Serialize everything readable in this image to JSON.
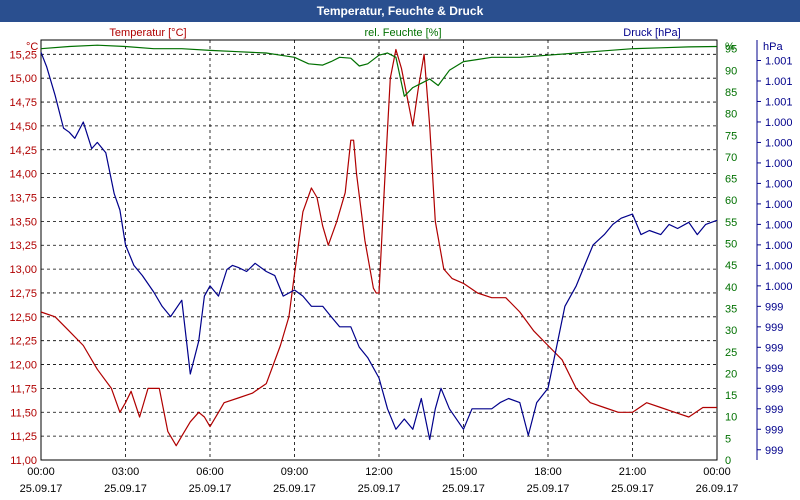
{
  "window": {
    "title": "Temperatur, Feuchte & Druck"
  },
  "chart_data": {
    "type": "line",
    "title": "Temperatur, Feuchte & Druck",
    "grid": true,
    "x": {
      "min_hour": 0,
      "max_hour": 24,
      "ticks": [
        {
          "hour": 0,
          "time": "00:00",
          "date": "25.09.17"
        },
        {
          "hour": 3,
          "time": "03:00",
          "date": "25.09.17"
        },
        {
          "hour": 6,
          "time": "06:00",
          "date": "25.09.17"
        },
        {
          "hour": 9,
          "time": "09:00",
          "date": "25.09.17"
        },
        {
          "hour": 12,
          "time": "12:00",
          "date": "25.09.17"
        },
        {
          "hour": 15,
          "time": "15:00",
          "date": "25.09.17"
        },
        {
          "hour": 18,
          "time": "18:00",
          "date": "25.09.17"
        },
        {
          "hour": 21,
          "time": "21:00",
          "date": "25.09.17"
        },
        {
          "hour": 24,
          "time": "00:00",
          "date": "26.09.17"
        }
      ]
    },
    "axes": {
      "temperature": {
        "label": "Temperatur [°C]",
        "unit": "°C",
        "color": "#b00000",
        "position": "left",
        "min": 11.0,
        "max": 15.4,
        "tick_values": [
          11.0,
          11.25,
          11.5,
          11.75,
          12.0,
          12.25,
          12.5,
          12.75,
          13.0,
          13.25,
          13.5,
          13.75,
          14.0,
          14.25,
          14.5,
          14.75,
          15.0,
          15.25
        ],
        "tick_labels": [
          "11,00",
          "11,25",
          "11,50",
          "11,75",
          "12,00",
          "12,25",
          "12,50",
          "12,75",
          "13,00",
          "13,25",
          "13,50",
          "13,75",
          "14,00",
          "14,25",
          "14,50",
          "14,75",
          "15,00",
          "15,25"
        ]
      },
      "humidity": {
        "label": "rel. Feuchte [%]",
        "unit": "%",
        "color": "#007000",
        "position": "right",
        "min": 0,
        "max": 97,
        "tick_values": [
          0,
          5,
          10,
          15,
          20,
          25,
          30,
          35,
          40,
          45,
          50,
          55,
          60,
          65,
          70,
          75,
          80,
          85,
          90,
          95
        ],
        "tick_labels": [
          "0",
          "5",
          "10",
          "15",
          "20",
          "25",
          "30",
          "35",
          "40",
          "45",
          "50",
          "55",
          "60",
          "65",
          "70",
          "75",
          "80",
          "85",
          "90",
          "95"
        ]
      },
      "pressure": {
        "label": "Druck [hPa]",
        "unit": "hPa",
        "color": "#00008b",
        "position": "right",
        "min": 0,
        "max": 20.5,
        "tick_values": [
          0.5,
          1.5,
          2.5,
          3.5,
          4.5,
          5.5,
          6.5,
          7.5,
          8.5,
          9.5,
          10.5,
          11.5,
          12.5,
          13.5,
          14.5,
          15.5,
          16.5,
          17.5,
          18.5,
          19.5
        ],
        "tick_labels": [
          "999",
          "999",
          "999",
          "999",
          "999",
          "999",
          "999",
          "999",
          "1.000",
          "1.000",
          "1.000",
          "1.000",
          "1.000",
          "1.000",
          "1.000",
          "1.000",
          "1.000",
          "1.001",
          "1.001",
          "1.001"
        ]
      }
    },
    "series": [
      {
        "name": "Temperatur [°C]",
        "axis": "temperature",
        "color": "#b00000",
        "x": [
          0,
          0.5,
          1,
          1.5,
          2,
          2.5,
          2.8,
          3,
          3.2,
          3.5,
          3.8,
          4,
          4.2,
          4.5,
          4.8,
          5,
          5.3,
          5.6,
          5.8,
          6,
          6.3,
          6.5,
          7,
          7.5,
          8,
          8.5,
          8.8,
          9,
          9.3,
          9.6,
          9.8,
          10,
          10.2,
          10.5,
          10.8,
          11,
          11.1,
          11.2,
          11.5,
          11.8,
          11.9,
          12,
          12.2,
          12.4,
          12.6,
          12.8,
          13,
          13.2,
          13.4,
          13.6,
          13.8,
          14,
          14.3,
          14.6,
          15,
          15.5,
          16,
          16.5,
          17,
          17.5,
          18,
          18.5,
          19,
          19.5,
          20,
          20.5,
          21,
          21.5,
          22,
          22.5,
          23,
          23.5,
          24
        ],
        "values": [
          12.55,
          12.5,
          12.35,
          12.2,
          11.95,
          11.75,
          11.5,
          11.6,
          11.72,
          11.45,
          11.75,
          11.75,
          11.75,
          11.3,
          11.15,
          11.25,
          11.4,
          11.5,
          11.45,
          11.35,
          11.5,
          11.6,
          11.65,
          11.7,
          11.8,
          12.2,
          12.5,
          12.95,
          13.6,
          13.85,
          13.75,
          13.45,
          13.25,
          13.5,
          13.8,
          14.35,
          14.35,
          14.0,
          13.3,
          12.8,
          12.75,
          12.75,
          13.9,
          15.0,
          15.3,
          15.1,
          14.8,
          14.5,
          14.9,
          15.25,
          14.5,
          13.5,
          13.0,
          12.9,
          12.85,
          12.75,
          12.7,
          12.7,
          12.55,
          12.35,
          12.2,
          12.05,
          11.75,
          11.6,
          11.55,
          11.5,
          11.5,
          11.6,
          11.55,
          11.5,
          11.45,
          11.55,
          11.55
        ]
      },
      {
        "name": "rel. Feuchte [%]",
        "axis": "humidity",
        "color": "#007000",
        "x": [
          0,
          1,
          2,
          3,
          4,
          5,
          6,
          7,
          8,
          8.5,
          9,
          9.5,
          10,
          10.3,
          10.6,
          11,
          11.3,
          11.6,
          12,
          12.3,
          12.6,
          12.9,
          13.2,
          13.5,
          13.8,
          14.1,
          14.5,
          15,
          15.5,
          16,
          17,
          18,
          19,
          20,
          21,
          22,
          23,
          24
        ],
        "values": [
          95,
          95.5,
          95.8,
          95.5,
          95,
          95,
          94.6,
          94.3,
          94,
          93.5,
          93,
          91.5,
          91.2,
          92,
          93,
          92.8,
          91,
          91.5,
          93.5,
          94,
          93,
          84,
          86,
          87,
          88,
          86.5,
          90,
          92,
          92.5,
          93,
          93,
          93.5,
          94,
          94.5,
          95,
          95.2,
          95.4,
          95.5
        ]
      },
      {
        "name": "Druck [hPa]",
        "axis": "pressure",
        "color": "#00008b",
        "x": [
          0,
          0.2,
          0.5,
          0.8,
          1,
          1.2,
          1.5,
          1.8,
          2,
          2.3,
          2.6,
          2.8,
          3,
          3.3,
          3.6,
          4,
          4.3,
          4.6,
          5,
          5.3,
          5.6,
          5.8,
          6,
          6.3,
          6.6,
          6.8,
          7,
          7.3,
          7.6,
          8,
          8.3,
          8.6,
          9,
          9.3,
          9.6,
          10,
          10.3,
          10.6,
          11,
          11.3,
          11.6,
          12,
          12.3,
          12.6,
          12.9,
          13.2,
          13.5,
          13.8,
          14,
          14.2,
          14.5,
          15,
          15.3,
          15.6,
          16,
          16.3,
          16.6,
          17,
          17.3,
          17.6,
          18,
          18.3,
          18.6,
          19,
          19.3,
          19.6,
          20,
          20.3,
          20.6,
          21,
          21.3,
          21.6,
          22,
          22.3,
          22.6,
          23,
          23.3,
          23.6,
          24
        ],
        "values": [
          19.9,
          19.2,
          17.8,
          16.2,
          16.0,
          15.7,
          16.5,
          15.2,
          15.5,
          15.0,
          13.0,
          12.2,
          10.5,
          9.5,
          9.0,
          8.2,
          7.5,
          7.0,
          7.8,
          4.2,
          5.8,
          8.0,
          8.5,
          8.0,
          9.3,
          9.5,
          9.4,
          9.2,
          9.6,
          9.2,
          9.0,
          8.0,
          8.3,
          8.0,
          7.5,
          7.5,
          7.0,
          6.5,
          6.5,
          5.5,
          5.0,
          4.0,
          2.5,
          1.5,
          2.0,
          1.5,
          3.0,
          1.0,
          2.5,
          3.5,
          2.5,
          1.5,
          2.5,
          2.5,
          2.5,
          2.8,
          3.0,
          2.8,
          1.2,
          2.8,
          3.5,
          5.5,
          7.5,
          8.5,
          9.5,
          10.5,
          11.0,
          11.5,
          11.8,
          12.0,
          11.0,
          11.2,
          11.0,
          11.5,
          11.3,
          11.6,
          11.0,
          11.5,
          11.7
        ]
      }
    ]
  }
}
